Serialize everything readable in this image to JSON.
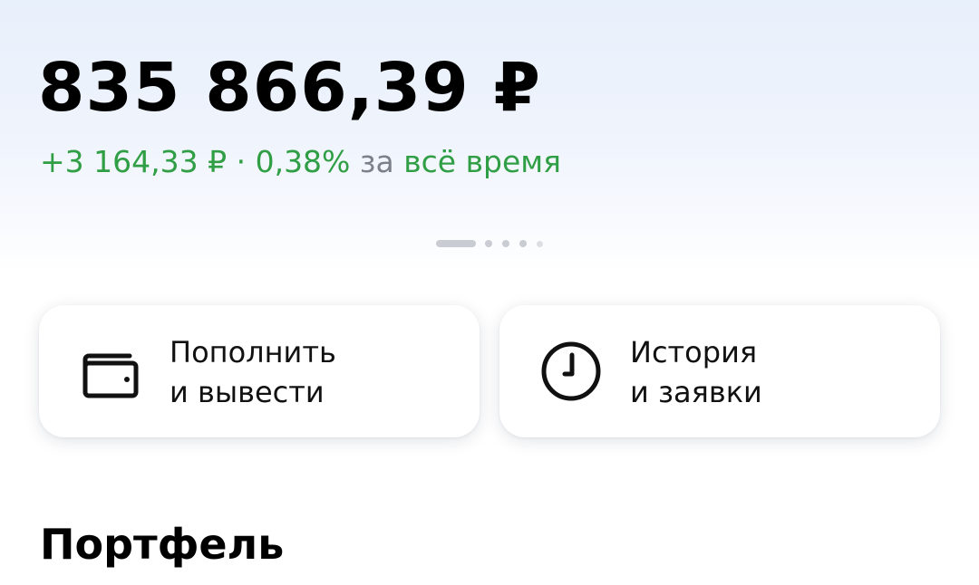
{
  "balance": {
    "amount": "835 866,39 ₽"
  },
  "change": {
    "absolute": "+3 164,33 ₽",
    "separator": " · ",
    "percent": "0,38%",
    "period_prefix": "за",
    "period": "всё время"
  },
  "pager": {
    "pages": 5,
    "active_index": 0
  },
  "actions": [
    {
      "label_line1": "Пополнить",
      "label_line2": "и вывести",
      "icon": "wallet-icon"
    },
    {
      "label_line1": "История",
      "label_line2": "и заявки",
      "icon": "clock-icon"
    }
  ],
  "portfolio": {
    "title": "Портфель"
  },
  "colors": {
    "positive": "#2f9e44",
    "muted": "#7c8088",
    "text": "#000000"
  }
}
